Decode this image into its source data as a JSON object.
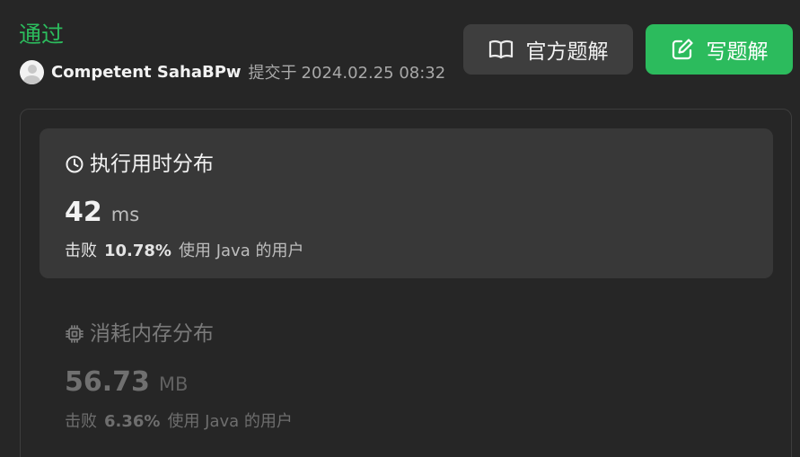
{
  "header": {
    "status": "通过",
    "author": "Competent SahaBPw",
    "submitted_label": "提交于",
    "submitted_time": "2024.02.25 08:32"
  },
  "actions": {
    "official_solution": "官方题解",
    "write_solution": "写题解"
  },
  "runtime": {
    "title": "执行用时分布",
    "value": "42",
    "unit": "ms",
    "beat_label": "击败",
    "beat_percent": "10.78%",
    "beat_suffix": "使用 Java 的用户",
    "icon": "clock-icon"
  },
  "memory": {
    "title": "消耗内存分布",
    "value": "56.73",
    "unit": "MB",
    "beat_label": "击败",
    "beat_percent": "6.36%",
    "beat_suffix": "使用 Java 的用户",
    "icon": "chip-icon"
  },
  "colors": {
    "accent": "#2cbb5d",
    "background": "#262626",
    "panel": "#383838",
    "secondary_button": "#3e3e3e"
  }
}
